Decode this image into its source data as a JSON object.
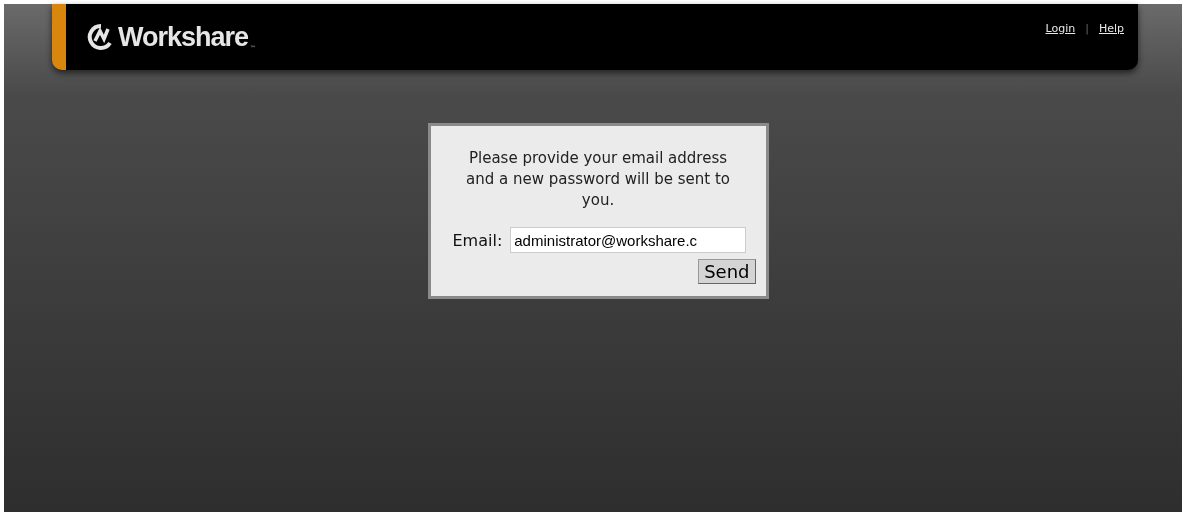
{
  "header": {
    "logo": {
      "name": "Workshare",
      "mark": "™"
    },
    "links": [
      {
        "label": "Login"
      },
      {
        "label": "Help"
      }
    ],
    "separator": "|"
  },
  "dialog": {
    "message": "Please provide your email address and a new password will be sent to you.",
    "email": {
      "label": "Email:",
      "value": "administrator@workshare.c"
    },
    "button": "Send"
  }
}
